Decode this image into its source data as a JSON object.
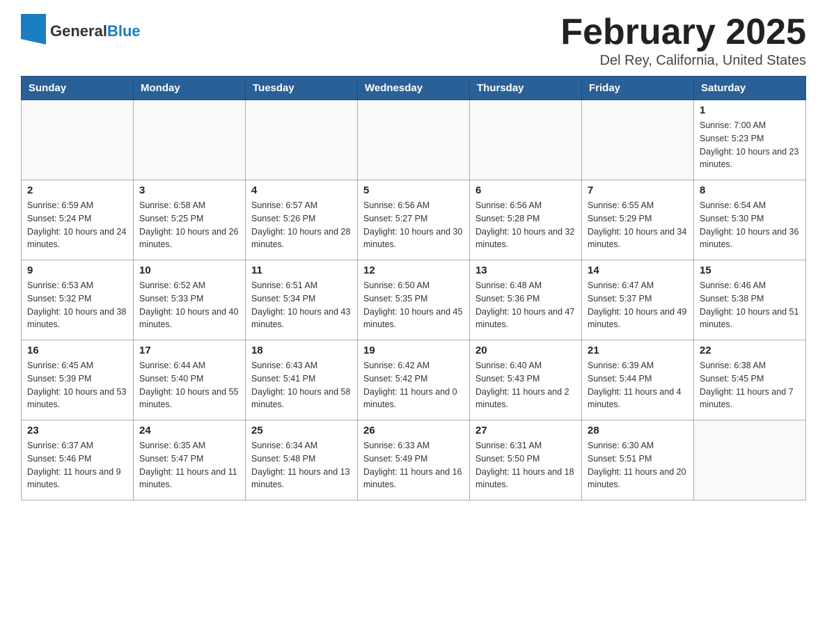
{
  "header": {
    "logo_general": "General",
    "logo_blue": "Blue",
    "month_title": "February 2025",
    "location": "Del Rey, California, United States"
  },
  "days_of_week": [
    "Sunday",
    "Monday",
    "Tuesday",
    "Wednesday",
    "Thursday",
    "Friday",
    "Saturday"
  ],
  "weeks": [
    [
      {
        "day": "",
        "info": ""
      },
      {
        "day": "",
        "info": ""
      },
      {
        "day": "",
        "info": ""
      },
      {
        "day": "",
        "info": ""
      },
      {
        "day": "",
        "info": ""
      },
      {
        "day": "",
        "info": ""
      },
      {
        "day": "1",
        "info": "Sunrise: 7:00 AM\nSunset: 5:23 PM\nDaylight: 10 hours and 23 minutes."
      }
    ],
    [
      {
        "day": "2",
        "info": "Sunrise: 6:59 AM\nSunset: 5:24 PM\nDaylight: 10 hours and 24 minutes."
      },
      {
        "day": "3",
        "info": "Sunrise: 6:58 AM\nSunset: 5:25 PM\nDaylight: 10 hours and 26 minutes."
      },
      {
        "day": "4",
        "info": "Sunrise: 6:57 AM\nSunset: 5:26 PM\nDaylight: 10 hours and 28 minutes."
      },
      {
        "day": "5",
        "info": "Sunrise: 6:56 AM\nSunset: 5:27 PM\nDaylight: 10 hours and 30 minutes."
      },
      {
        "day": "6",
        "info": "Sunrise: 6:56 AM\nSunset: 5:28 PM\nDaylight: 10 hours and 32 minutes."
      },
      {
        "day": "7",
        "info": "Sunrise: 6:55 AM\nSunset: 5:29 PM\nDaylight: 10 hours and 34 minutes."
      },
      {
        "day": "8",
        "info": "Sunrise: 6:54 AM\nSunset: 5:30 PM\nDaylight: 10 hours and 36 minutes."
      }
    ],
    [
      {
        "day": "9",
        "info": "Sunrise: 6:53 AM\nSunset: 5:32 PM\nDaylight: 10 hours and 38 minutes."
      },
      {
        "day": "10",
        "info": "Sunrise: 6:52 AM\nSunset: 5:33 PM\nDaylight: 10 hours and 40 minutes."
      },
      {
        "day": "11",
        "info": "Sunrise: 6:51 AM\nSunset: 5:34 PM\nDaylight: 10 hours and 43 minutes."
      },
      {
        "day": "12",
        "info": "Sunrise: 6:50 AM\nSunset: 5:35 PM\nDaylight: 10 hours and 45 minutes."
      },
      {
        "day": "13",
        "info": "Sunrise: 6:48 AM\nSunset: 5:36 PM\nDaylight: 10 hours and 47 minutes."
      },
      {
        "day": "14",
        "info": "Sunrise: 6:47 AM\nSunset: 5:37 PM\nDaylight: 10 hours and 49 minutes."
      },
      {
        "day": "15",
        "info": "Sunrise: 6:46 AM\nSunset: 5:38 PM\nDaylight: 10 hours and 51 minutes."
      }
    ],
    [
      {
        "day": "16",
        "info": "Sunrise: 6:45 AM\nSunset: 5:39 PM\nDaylight: 10 hours and 53 minutes."
      },
      {
        "day": "17",
        "info": "Sunrise: 6:44 AM\nSunset: 5:40 PM\nDaylight: 10 hours and 55 minutes."
      },
      {
        "day": "18",
        "info": "Sunrise: 6:43 AM\nSunset: 5:41 PM\nDaylight: 10 hours and 58 minutes."
      },
      {
        "day": "19",
        "info": "Sunrise: 6:42 AM\nSunset: 5:42 PM\nDaylight: 11 hours and 0 minutes."
      },
      {
        "day": "20",
        "info": "Sunrise: 6:40 AM\nSunset: 5:43 PM\nDaylight: 11 hours and 2 minutes."
      },
      {
        "day": "21",
        "info": "Sunrise: 6:39 AM\nSunset: 5:44 PM\nDaylight: 11 hours and 4 minutes."
      },
      {
        "day": "22",
        "info": "Sunrise: 6:38 AM\nSunset: 5:45 PM\nDaylight: 11 hours and 7 minutes."
      }
    ],
    [
      {
        "day": "23",
        "info": "Sunrise: 6:37 AM\nSunset: 5:46 PM\nDaylight: 11 hours and 9 minutes."
      },
      {
        "day": "24",
        "info": "Sunrise: 6:35 AM\nSunset: 5:47 PM\nDaylight: 11 hours and 11 minutes."
      },
      {
        "day": "25",
        "info": "Sunrise: 6:34 AM\nSunset: 5:48 PM\nDaylight: 11 hours and 13 minutes."
      },
      {
        "day": "26",
        "info": "Sunrise: 6:33 AM\nSunset: 5:49 PM\nDaylight: 11 hours and 16 minutes."
      },
      {
        "day": "27",
        "info": "Sunrise: 6:31 AM\nSunset: 5:50 PM\nDaylight: 11 hours and 18 minutes."
      },
      {
        "day": "28",
        "info": "Sunrise: 6:30 AM\nSunset: 5:51 PM\nDaylight: 11 hours and 20 minutes."
      },
      {
        "day": "",
        "info": ""
      }
    ]
  ]
}
